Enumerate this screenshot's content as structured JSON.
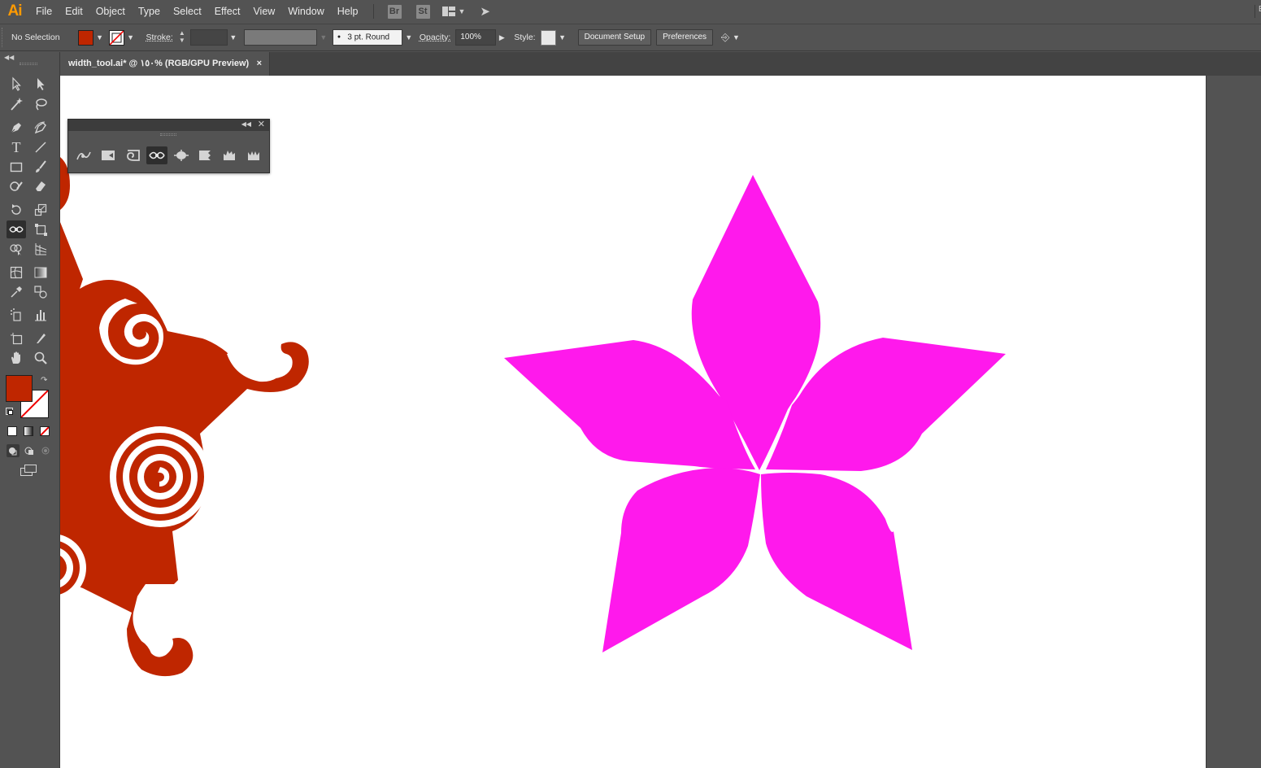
{
  "app": {
    "logo": "Ai"
  },
  "menu": [
    "File",
    "Edit",
    "Object",
    "Type",
    "Select",
    "Effect",
    "View",
    "Window",
    "Help"
  ],
  "app_buttons": [
    "Br",
    "St"
  ],
  "menubar_right": "E",
  "control": {
    "selection": "No Selection",
    "stroke_label": "Stroke:",
    "brush": "3 pt. Round",
    "opacity_label": "Opacity:",
    "opacity_value": "100%",
    "style_label": "Style:",
    "document_setup": "Document Setup",
    "preferences": "Preferences",
    "fill_color": "#bf2600"
  },
  "tab": {
    "title": "width_tool.ai* @ ١٥٠% (RGB/GPU Preview)",
    "close": "×"
  },
  "colors": {
    "fill": "#bf2600",
    "star": "#ff19ec",
    "ui_bg": "#535353"
  }
}
